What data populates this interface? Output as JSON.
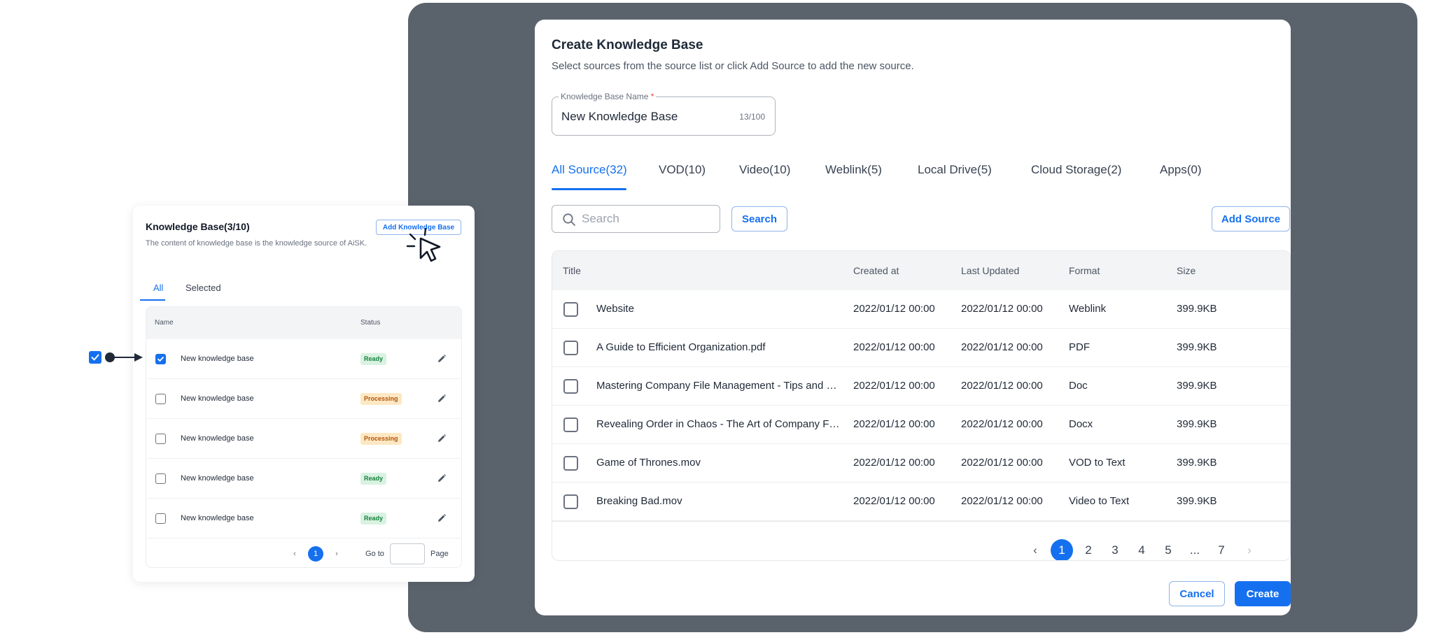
{
  "dialog": {
    "title": "Create Knowledge Base",
    "subtitle": "Select sources from the source list or click Add Source to add the new source.",
    "name_field": {
      "label": "Knowledge Base Name",
      "required_mark": "*",
      "value": "New Knowledge Base",
      "counter": "13/100"
    },
    "tabs": [
      {
        "label": "All Source(32)",
        "active": true
      },
      {
        "label": "VOD(10)"
      },
      {
        "label": "Video(10)"
      },
      {
        "label": "Weblink(5)"
      },
      {
        "label": "Local Drive(5)"
      },
      {
        "label": "Cloud Storage(2)"
      },
      {
        "label": "Apps(0)"
      }
    ],
    "search": {
      "placeholder": "Search",
      "button": "Search"
    },
    "add_source_button": "Add Source",
    "table": {
      "columns": [
        "Title",
        "Created at",
        "Last Updated",
        "Format",
        "Size"
      ],
      "rows": [
        {
          "title": "Website",
          "created": "2022/01/12 00:00",
          "updated": "2022/01/12 00:00",
          "format": "Weblink",
          "size": "399.9KB"
        },
        {
          "title": "A Guide to Efficient Organization.pdf",
          "created": "2022/01/12 00:00",
          "updated": "2022/01/12 00:00",
          "format": "PDF",
          "size": "399.9KB"
        },
        {
          "title": "Mastering Company File Management - Tips and S...",
          "created": "2022/01/12 00:00",
          "updated": "2022/01/12 00:00",
          "format": "Doc",
          "size": "399.9KB"
        },
        {
          "title": "Revealing Order in Chaos - The Art of Company Fil...",
          "created": "2022/01/12 00:00",
          "updated": "2022/01/12 00:00",
          "format": "Docx",
          "size": "399.9KB"
        },
        {
          "title": "Game of Thrones.mov",
          "created": "2022/01/12 00:00",
          "updated": "2022/01/12 00:00",
          "format": "VOD to Text",
          "size": "399.9KB"
        },
        {
          "title": "Breaking Bad.mov",
          "created": "2022/01/12 00:00",
          "updated": "2022/01/12 00:00",
          "format": "Video to Text",
          "size": "399.9KB"
        }
      ]
    },
    "pagination": {
      "pages": [
        "1",
        "2",
        "3",
        "4",
        "5",
        "...",
        "7"
      ],
      "current": "1",
      "prev": "‹",
      "next": "›"
    },
    "cancel_button": "Cancel",
    "create_button": "Create"
  },
  "kb_panel": {
    "title": "Knowledge Base(3/10)",
    "description": "The content of knowledge base is the knowledge source of AiSK.",
    "add_button": "Add Knowledge Base",
    "tabs": [
      {
        "label": "All",
        "active": true
      },
      {
        "label": "Selected"
      }
    ],
    "columns": [
      "Name",
      "Status"
    ],
    "rows": [
      {
        "name": "New knowledge base",
        "status": "Ready",
        "checked": true
      },
      {
        "name": "New knowledge base",
        "status": "Processing",
        "checked": false
      },
      {
        "name": "New knowledge base",
        "status": "Processing",
        "checked": false
      },
      {
        "name": "New knowledge base",
        "status": "Ready",
        "checked": false
      },
      {
        "name": "New knowledge base",
        "status": "Ready",
        "checked": false
      }
    ],
    "pagination": {
      "current": "1",
      "prev": "‹",
      "next": "›",
      "goto_label": "Go to",
      "page_label": "Page"
    }
  },
  "colors": {
    "accent": "#1570ef",
    "backdrop": "#5a626c",
    "ready_bg": "#d9f2e1",
    "processing_bg": "#fde8c3"
  },
  "icons": [
    "search-icon",
    "checkbox-icon",
    "edit-pencil-icon",
    "chevron-left-icon",
    "chevron-right-icon",
    "pointer-cursor-icon",
    "arrow-connector-icon"
  ]
}
